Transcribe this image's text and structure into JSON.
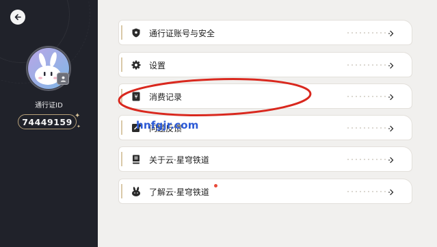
{
  "sidebar": {
    "pass_label": "通行证ID",
    "user_id": "74449159"
  },
  "menu": {
    "items": [
      {
        "label": "通行证账号与安全",
        "icon": "shield-icon"
      },
      {
        "label": "设置",
        "icon": "gear-icon"
      },
      {
        "label": "消费记录",
        "icon": "receipt-icon"
      },
      {
        "label": "问题反馈",
        "icon": "feedback-icon"
      },
      {
        "label": "关于云·星穹铁道",
        "icon": "book-icon"
      },
      {
        "label": "了解云·星穹铁道",
        "icon": "bunny-icon"
      }
    ]
  },
  "watermark": "hnfgjr.com",
  "colors": {
    "sidebar_bg": "#20222a",
    "page_bg": "#f1f0ee",
    "accent_gold": "#b9a27a",
    "annotation_red": "#d9281e",
    "watermark_blue": "#2d5bd6"
  }
}
